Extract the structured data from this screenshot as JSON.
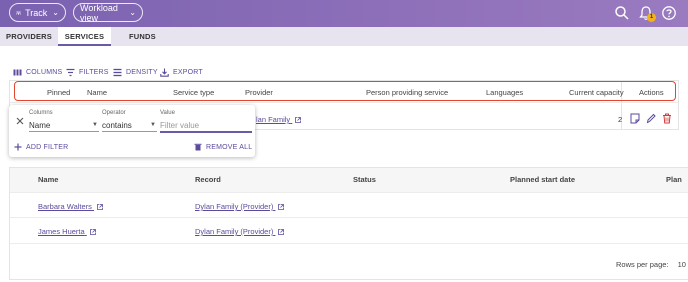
{
  "header": {
    "app_pill": "Track",
    "view_pill": "Workload view",
    "notification_count": "1"
  },
  "tabs": [
    "PROVIDERS",
    "SERVICES",
    "FUNDS"
  ],
  "toolbar": {
    "columns": "COLUMNS",
    "filters": "FILTERS",
    "density": "DENSITY",
    "export": "EXPORT"
  },
  "services_grid": {
    "headers": [
      "Pinned",
      "Name",
      "Service type",
      "Provider",
      "Person providing service",
      "Languages",
      "Current capacity",
      "Actions"
    ],
    "row": {
      "provider_partial": "lan Family",
      "capacity": "2"
    }
  },
  "filter_panel": {
    "columns_label": "Columns",
    "columns_value": "Name",
    "operator_label": "Operator",
    "operator_value": "contains",
    "value_label": "Value",
    "value_placeholder": "Filter value",
    "add_filter": "ADD FILTER",
    "remove_all": "REMOVE ALL"
  },
  "people_grid": {
    "headers": [
      "Name",
      "Record",
      "Status",
      "Planned start date",
      "Plan"
    ],
    "rows": [
      {
        "name": "Barbara Walters",
        "record": "Dylan Family (Provider)"
      },
      {
        "name": "James Huerta",
        "record": "Dylan Family (Provider)"
      }
    ],
    "rows_per_page_label": "Rows per page:",
    "rows_per_page_value": "10"
  },
  "colors": {
    "header_gradient_start": "#7a62b0",
    "accent": "#5c4a9c",
    "highlight_border": "#e2462f",
    "badge": "#f1b21c",
    "delete_icon": "#d23b3b"
  }
}
